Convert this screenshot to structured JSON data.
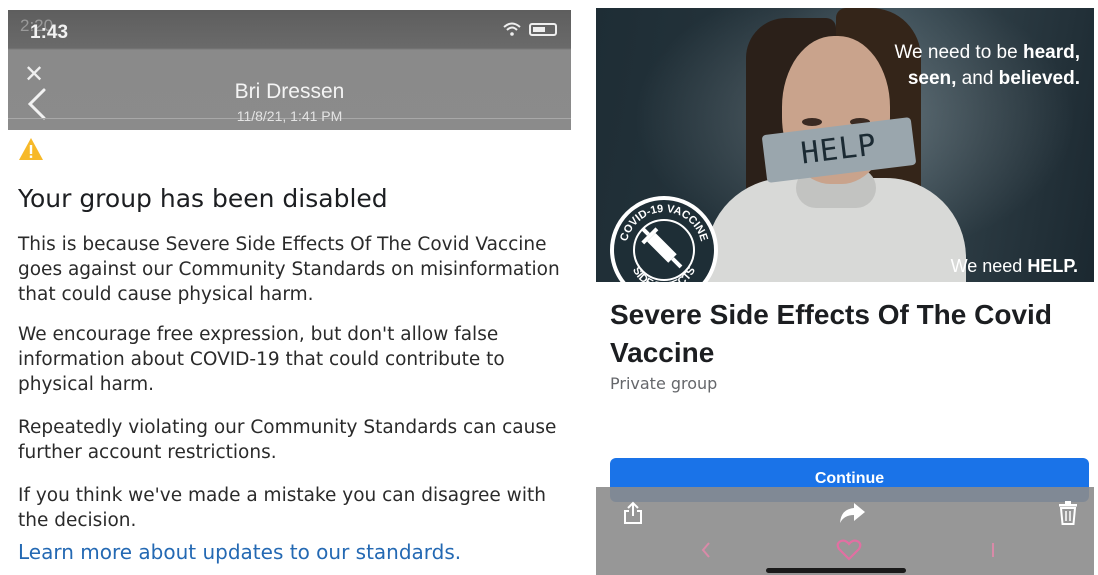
{
  "left": {
    "status": {
      "ghost_time": "2:20",
      "time": "1:43"
    },
    "header": {
      "name": "Bri Dressen",
      "date": "11/8/21, 1:41 PM"
    },
    "headline": "Your group has been disabled",
    "paragraphs": [
      "This is because Severe Side Effects Of The Covid Vaccine goes against our Community Standards on misinformation that could cause physical harm.",
      "We encourage free expression, but don't allow false information about COVID-19 that could contribute to physical harm.",
      "Repeatedly violating our Community Standards can cause further account restrictions.",
      "If you think we've made a mistake you can disagree with the decision."
    ],
    "learn_more": "Learn more about updates to our standards."
  },
  "right": {
    "cover": {
      "line1_a": "We need to be ",
      "line1_b": "heard,",
      "line2_a": "seen,",
      "line2_b": " and ",
      "line2_c": "believed.",
      "foot_a": "We need ",
      "foot_b": "HELP.",
      "tape": "HELP",
      "badge_top": "COVID-19 VACCINE",
      "badge_bottom": "SIDE EFFECTS"
    },
    "group_name": "Severe Side Effects Of The Covid Vaccine",
    "group_type": "Private group",
    "continue_label": "Continue"
  },
  "colors": {
    "link": "#2469b3",
    "button": "#1a73e8",
    "warning": "#f7b928",
    "heart": "#e26fa2"
  }
}
